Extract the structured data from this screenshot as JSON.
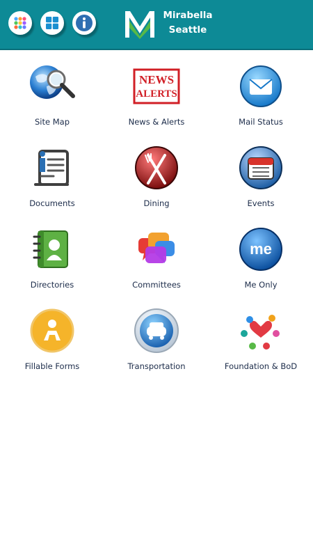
{
  "header": {
    "brand_line1": "Mirabella",
    "brand_line2": "Seattle",
    "bg_color": "#0d8a96",
    "buttons": [
      {
        "icon": "apps-grid-icon"
      },
      {
        "icon": "windows-grid-icon"
      },
      {
        "icon": "info-icon"
      }
    ]
  },
  "tiles": [
    {
      "label": "Site Map",
      "icon": "globe-magnifier-icon"
    },
    {
      "label": "News & Alerts",
      "icon": "news-alerts-stamp-icon"
    },
    {
      "label": "Mail Status",
      "icon": "envelope-icon"
    },
    {
      "label": "Documents",
      "icon": "document-scroll-icon"
    },
    {
      "label": "Dining",
      "icon": "fork-knife-icon"
    },
    {
      "label": "Events",
      "icon": "calendar-icon"
    },
    {
      "label": "Directories",
      "icon": "contact-book-icon"
    },
    {
      "label": "Committees",
      "icon": "chat-bubbles-icon"
    },
    {
      "label": "Me Only",
      "icon": "me-badge-icon"
    },
    {
      "label": "Fillable Forms",
      "icon": "person-circle-icon"
    },
    {
      "label": "Transportation",
      "icon": "car-icon"
    },
    {
      "label": "Foundation & BoD",
      "icon": "community-heart-icon"
    }
  ]
}
